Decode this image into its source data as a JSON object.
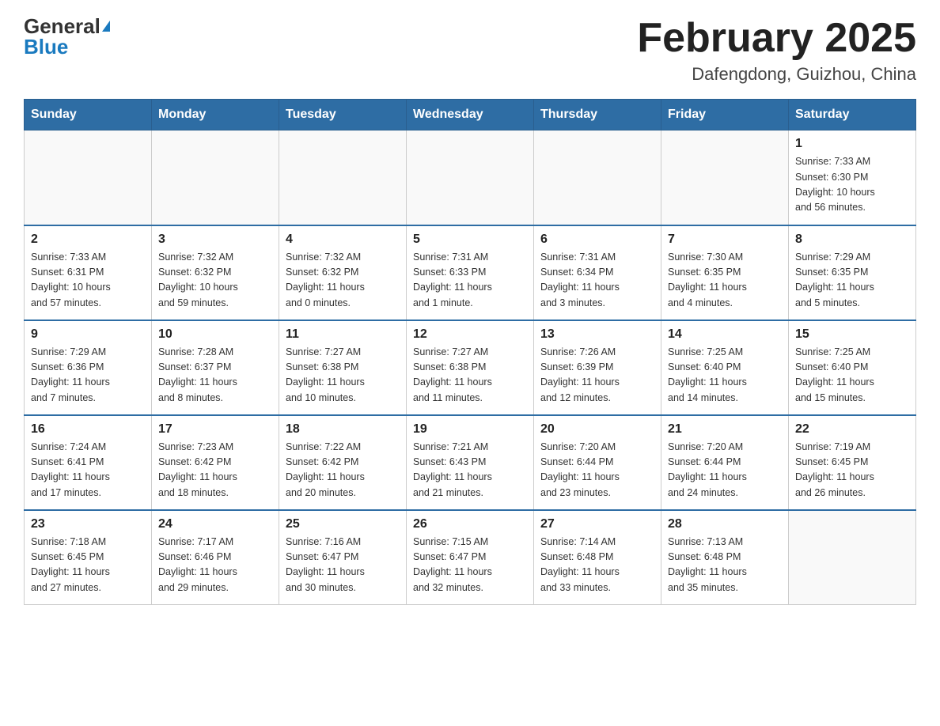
{
  "header": {
    "logo_general": "General",
    "logo_blue": "Blue",
    "cal_title": "February 2025",
    "cal_subtitle": "Dafengdong, Guizhou, China"
  },
  "days_of_week": [
    "Sunday",
    "Monday",
    "Tuesday",
    "Wednesday",
    "Thursday",
    "Friday",
    "Saturday"
  ],
  "weeks": [
    [
      {
        "day": "",
        "info": ""
      },
      {
        "day": "",
        "info": ""
      },
      {
        "day": "",
        "info": ""
      },
      {
        "day": "",
        "info": ""
      },
      {
        "day": "",
        "info": ""
      },
      {
        "day": "",
        "info": ""
      },
      {
        "day": "1",
        "info": "Sunrise: 7:33 AM\nSunset: 6:30 PM\nDaylight: 10 hours\nand 56 minutes."
      }
    ],
    [
      {
        "day": "2",
        "info": "Sunrise: 7:33 AM\nSunset: 6:31 PM\nDaylight: 10 hours\nand 57 minutes."
      },
      {
        "day": "3",
        "info": "Sunrise: 7:32 AM\nSunset: 6:32 PM\nDaylight: 10 hours\nand 59 minutes."
      },
      {
        "day": "4",
        "info": "Sunrise: 7:32 AM\nSunset: 6:32 PM\nDaylight: 11 hours\nand 0 minutes."
      },
      {
        "day": "5",
        "info": "Sunrise: 7:31 AM\nSunset: 6:33 PM\nDaylight: 11 hours\nand 1 minute."
      },
      {
        "day": "6",
        "info": "Sunrise: 7:31 AM\nSunset: 6:34 PM\nDaylight: 11 hours\nand 3 minutes."
      },
      {
        "day": "7",
        "info": "Sunrise: 7:30 AM\nSunset: 6:35 PM\nDaylight: 11 hours\nand 4 minutes."
      },
      {
        "day": "8",
        "info": "Sunrise: 7:29 AM\nSunset: 6:35 PM\nDaylight: 11 hours\nand 5 minutes."
      }
    ],
    [
      {
        "day": "9",
        "info": "Sunrise: 7:29 AM\nSunset: 6:36 PM\nDaylight: 11 hours\nand 7 minutes."
      },
      {
        "day": "10",
        "info": "Sunrise: 7:28 AM\nSunset: 6:37 PM\nDaylight: 11 hours\nand 8 minutes."
      },
      {
        "day": "11",
        "info": "Sunrise: 7:27 AM\nSunset: 6:38 PM\nDaylight: 11 hours\nand 10 minutes."
      },
      {
        "day": "12",
        "info": "Sunrise: 7:27 AM\nSunset: 6:38 PM\nDaylight: 11 hours\nand 11 minutes."
      },
      {
        "day": "13",
        "info": "Sunrise: 7:26 AM\nSunset: 6:39 PM\nDaylight: 11 hours\nand 12 minutes."
      },
      {
        "day": "14",
        "info": "Sunrise: 7:25 AM\nSunset: 6:40 PM\nDaylight: 11 hours\nand 14 minutes."
      },
      {
        "day": "15",
        "info": "Sunrise: 7:25 AM\nSunset: 6:40 PM\nDaylight: 11 hours\nand 15 minutes."
      }
    ],
    [
      {
        "day": "16",
        "info": "Sunrise: 7:24 AM\nSunset: 6:41 PM\nDaylight: 11 hours\nand 17 minutes."
      },
      {
        "day": "17",
        "info": "Sunrise: 7:23 AM\nSunset: 6:42 PM\nDaylight: 11 hours\nand 18 minutes."
      },
      {
        "day": "18",
        "info": "Sunrise: 7:22 AM\nSunset: 6:42 PM\nDaylight: 11 hours\nand 20 minutes."
      },
      {
        "day": "19",
        "info": "Sunrise: 7:21 AM\nSunset: 6:43 PM\nDaylight: 11 hours\nand 21 minutes."
      },
      {
        "day": "20",
        "info": "Sunrise: 7:20 AM\nSunset: 6:44 PM\nDaylight: 11 hours\nand 23 minutes."
      },
      {
        "day": "21",
        "info": "Sunrise: 7:20 AM\nSunset: 6:44 PM\nDaylight: 11 hours\nand 24 minutes."
      },
      {
        "day": "22",
        "info": "Sunrise: 7:19 AM\nSunset: 6:45 PM\nDaylight: 11 hours\nand 26 minutes."
      }
    ],
    [
      {
        "day": "23",
        "info": "Sunrise: 7:18 AM\nSunset: 6:45 PM\nDaylight: 11 hours\nand 27 minutes."
      },
      {
        "day": "24",
        "info": "Sunrise: 7:17 AM\nSunset: 6:46 PM\nDaylight: 11 hours\nand 29 minutes."
      },
      {
        "day": "25",
        "info": "Sunrise: 7:16 AM\nSunset: 6:47 PM\nDaylight: 11 hours\nand 30 minutes."
      },
      {
        "day": "26",
        "info": "Sunrise: 7:15 AM\nSunset: 6:47 PM\nDaylight: 11 hours\nand 32 minutes."
      },
      {
        "day": "27",
        "info": "Sunrise: 7:14 AM\nSunset: 6:48 PM\nDaylight: 11 hours\nand 33 minutes."
      },
      {
        "day": "28",
        "info": "Sunrise: 7:13 AM\nSunset: 6:48 PM\nDaylight: 11 hours\nand 35 minutes."
      },
      {
        "day": "",
        "info": ""
      }
    ]
  ]
}
